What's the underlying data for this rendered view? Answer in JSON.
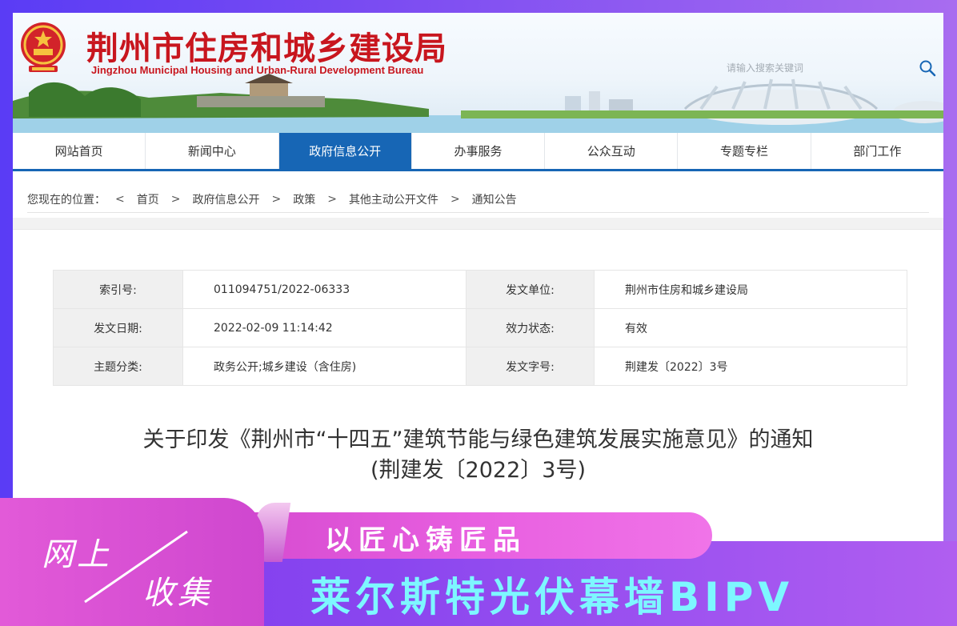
{
  "header": {
    "title": "荆州市住房和城乡建设局",
    "subtitle": "Jingzhou Municipal Housing and Urban-Rural Development Bureau",
    "search_placeholder": "请输入搜索关键词"
  },
  "nav": {
    "items": [
      {
        "label": "网站首页"
      },
      {
        "label": "新闻中心"
      },
      {
        "label": "政府信息公开",
        "active": true
      },
      {
        "label": "办事服务"
      },
      {
        "label": "公众互动"
      },
      {
        "label": "专题专栏"
      },
      {
        "label": "部门工作"
      }
    ]
  },
  "breadcrumb": {
    "prefix": "您现在的位置：",
    "separator": ">",
    "first_separator": "<",
    "items": [
      "首页",
      "政府信息公开",
      "政策",
      "其他主动公开文件",
      "通知公告"
    ]
  },
  "meta": {
    "rows": [
      {
        "k1": "索引号:",
        "v1": "011094751/2022-06333",
        "k2": "发文单位:",
        "v2": "荆州市住房和城乡建设局"
      },
      {
        "k1": "发文日期:",
        "v1": "2022-02-09 11:14:42",
        "k2": "效力状态:",
        "v2": "有效"
      },
      {
        "k1": "主题分类:",
        "v1": "政务公开;城乡建设（含住房)",
        "k2": "发文字号:",
        "v2": "荆建发〔2022〕3号"
      }
    ]
  },
  "document": {
    "title_line1": "关于印发《荆州市“十四五”建筑节能与绿色建筑发展实施意见》的通知",
    "title_line2": "(荆建发〔2022〕3号)"
  },
  "promo": {
    "badge_line1": "网上",
    "badge_line2": "收集",
    "slogan": "以匠心铸匠品",
    "product": "莱尔斯特光伏幕墙BIPV"
  },
  "colors": {
    "brand_red": "#c8161e",
    "nav_active": "#1766b5",
    "promo_purple": "#7a3af0",
    "promo_pink": "#e25ad8",
    "product_cyan": "#7df7ff"
  }
}
